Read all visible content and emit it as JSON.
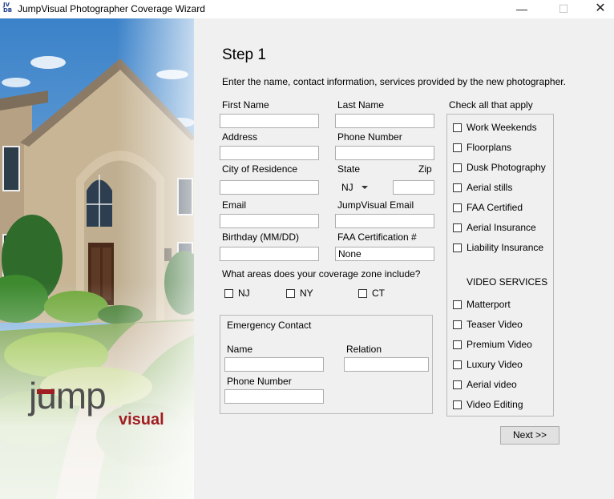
{
  "window": {
    "title": "JumpVisual Photographer Coverage Wizard",
    "icon_text_top": "JV",
    "icon_text_bottom": "DB",
    "minimize_glyph": "—",
    "maximize_glyph": "☐",
    "close_glyph": "✕"
  },
  "brand": {
    "logo_word1": "jump",
    "logo_word2": "visual",
    "accent_color": "#a01d22"
  },
  "step": {
    "title": "Step 1",
    "intro": "Enter the name, contact information, services provided by the new photographer."
  },
  "form": {
    "first_name_label": "First Name",
    "last_name_label": "Last Name",
    "address_label": "Address",
    "phone_label": "Phone Number",
    "city_label": "City of Residence",
    "state_label": "State",
    "state_value": "NJ",
    "zip_label": "Zip",
    "email_label": "Email",
    "jv_email_label": "JumpVisual Email",
    "birthday_label": "Birthday (MM/DD)",
    "faa_label": "FAA Certification #",
    "faa_value": "None"
  },
  "coverage": {
    "question": "What areas does your coverage zone include?",
    "options": [
      "NJ",
      "NY",
      "CT"
    ]
  },
  "emergency": {
    "title": "Emergency Contact",
    "name_label": "Name",
    "relation_label": "Relation",
    "phone_label": "Phone Number"
  },
  "services": {
    "header": "Check all that apply",
    "photo_items": [
      "Work Weekends",
      "Floorplans",
      "Dusk Photography",
      "Aerial stills",
      "FAA Certified",
      "Aerial Insurance",
      "Liability Insurance"
    ],
    "video_header": "VIDEO SERVICES",
    "video_items": [
      "Matterport",
      "Teaser Video",
      "Premium Video",
      "Luxury Video",
      "Aerial video",
      "Video Editing"
    ]
  },
  "next_button": "Next >>"
}
